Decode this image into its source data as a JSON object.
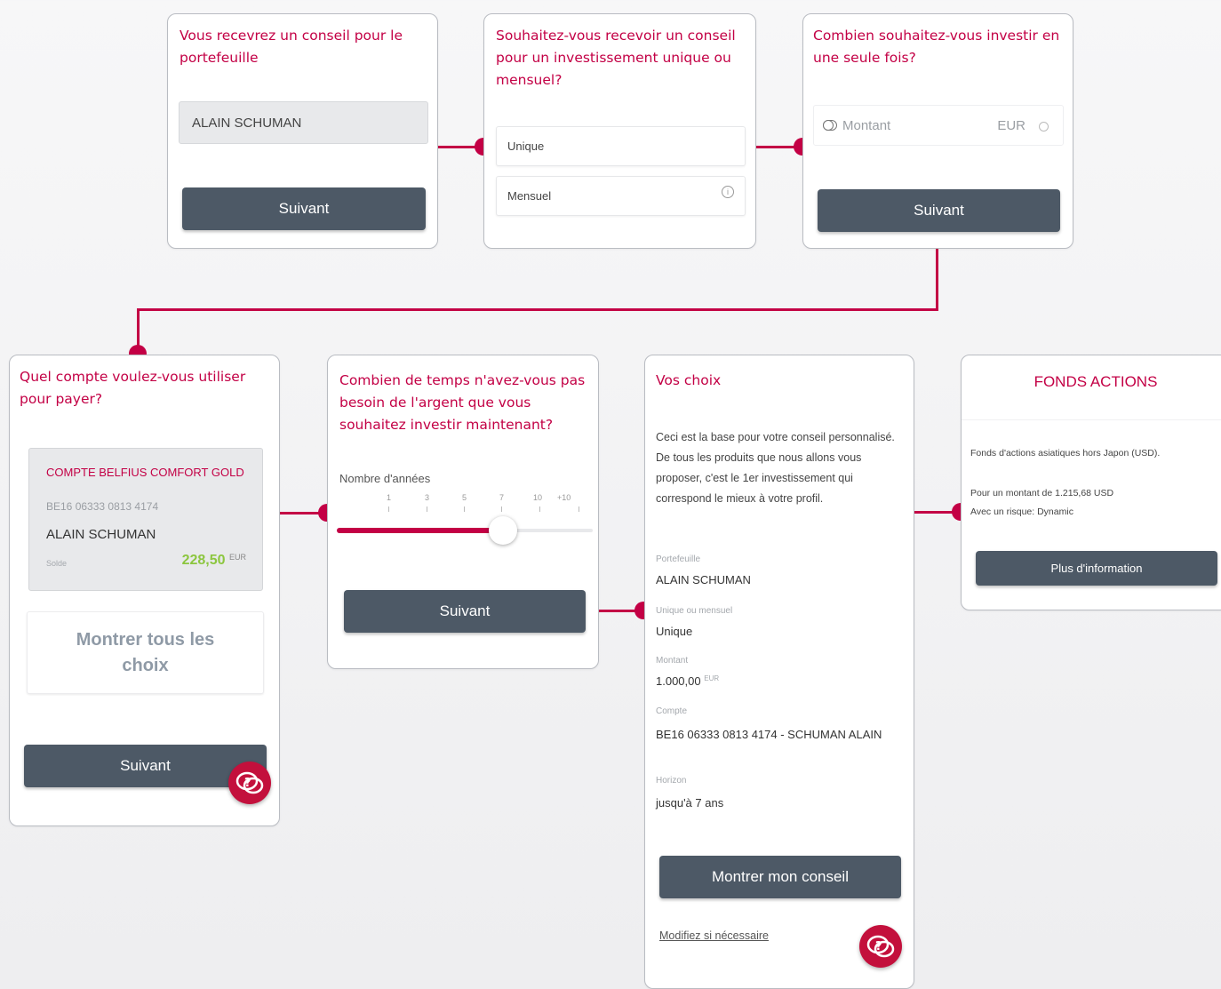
{
  "card1": {
    "question": "Vous recevrez un conseil pour le portefeuille",
    "portfolio_name": "ALAIN SCHUMAN",
    "next_label": "Suivant"
  },
  "card2": {
    "question": "Souhaitez-vous recevoir un conseil pour un investissement unique ou mensuel?",
    "option_unique": "Unique",
    "option_monthly": "Mensuel"
  },
  "card3": {
    "question": "Combien souhaitez-vous investir en une seule fois?",
    "amount_placeholder": "Montant",
    "currency": "EUR",
    "next_label": "Suivant"
  },
  "card4": {
    "question": "Quel compte voulez-vous utiliser pour payer?",
    "account_name": "COMPTE BELFIUS COMFORT GOLD",
    "iban": "BE16 06333 0813 4174",
    "holder": "ALAIN SCHUMAN",
    "balance_label": "Solde",
    "balance_value": "228,50",
    "balance_currency": "EUR",
    "show_all_label": "Montrer tous les choix",
    "next_label": "Suivant"
  },
  "card5": {
    "question": "Combien de temps n'avez-vous pas besoin de l'argent que vous souhaitez investir maintenant?",
    "slider_label": "Nombre d'années",
    "ticks": [
      "1",
      "3",
      "5",
      "7",
      "10",
      "+10"
    ],
    "slider_value": 7,
    "next_label": "Suivant"
  },
  "card6": {
    "title": "Vos choix",
    "intro": "Ceci est la base pour votre conseil personnalisé. De tous les produits que nous allons vous proposer, c'est le 1er investissement qui correspond le mieux à votre profil.",
    "portfolio_label": "Portefeuille",
    "portfolio_value": "ALAIN SCHUMAN",
    "type_label": "Unique ou mensuel",
    "type_value": "Unique",
    "amount_label": "Montant",
    "amount_value": "1.000,00",
    "amount_currency": "EUR",
    "account_label": "Compte",
    "account_value": "BE16 06333 0813 4174 - SCHUMAN ALAIN",
    "horizon_label": "Horizon",
    "horizon_value": "jusqu'à 7 ans",
    "show_advice_label": "Montrer mon conseil",
    "modify_label": "Modifiez si nécessaire"
  },
  "card7": {
    "title": "FONDS ACTIONS",
    "description": "Fonds d'actions asiatiques hors Japon (USD).",
    "amount_line": "Pour un montant de 1.215,68 USD",
    "risk_line": "Avec un risque: Dynamic",
    "more_info_label": "Plus d'information"
  },
  "colors": {
    "accent": "#c30045",
    "button": "#4d5966",
    "balance": "#8cc63f"
  },
  "icons": [
    "help-chat-icon",
    "toggle-icon",
    "info-icon",
    "clear-icon"
  ]
}
